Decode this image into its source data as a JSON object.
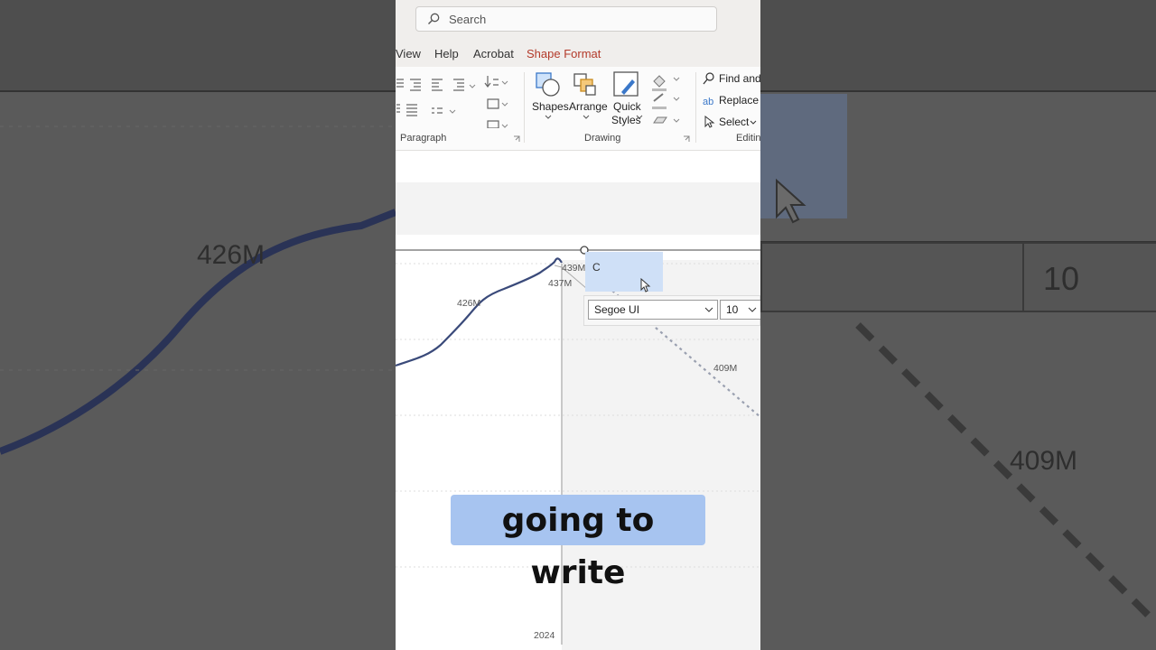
{
  "search": {
    "placeholder": "Search"
  },
  "tabs": [
    {
      "label": "View"
    },
    {
      "label": "Help"
    },
    {
      "label": "Acrobat"
    },
    {
      "label": "Shape Format"
    }
  ],
  "ribbon": {
    "paragraph_label": "Paragraph",
    "drawing_label": "Drawing",
    "editing_label": "Editing",
    "shapes_label": "Shapes",
    "arrange_label": "Arrange",
    "quick_label": "Quick",
    "styles_label": "Styles",
    "find_label": "Find and",
    "replace_label": "Replace F",
    "select_label": "Select"
  },
  "chart": {
    "label_439": "439M",
    "label_437": "437M",
    "label_426": "426M",
    "label_409": "409M",
    "year_2024": "2024"
  },
  "edit_box_text": "C",
  "mini_toolbar": {
    "font": "Segoe UI",
    "size": "10"
  },
  "background": {
    "label_426": "426M",
    "label_409": "409M",
    "size": "10"
  },
  "caption": "going to write",
  "colors": {
    "accent_tab": "#b33a2a",
    "series": "#3a4a7a",
    "caption_bg": "#a7c4f0"
  }
}
